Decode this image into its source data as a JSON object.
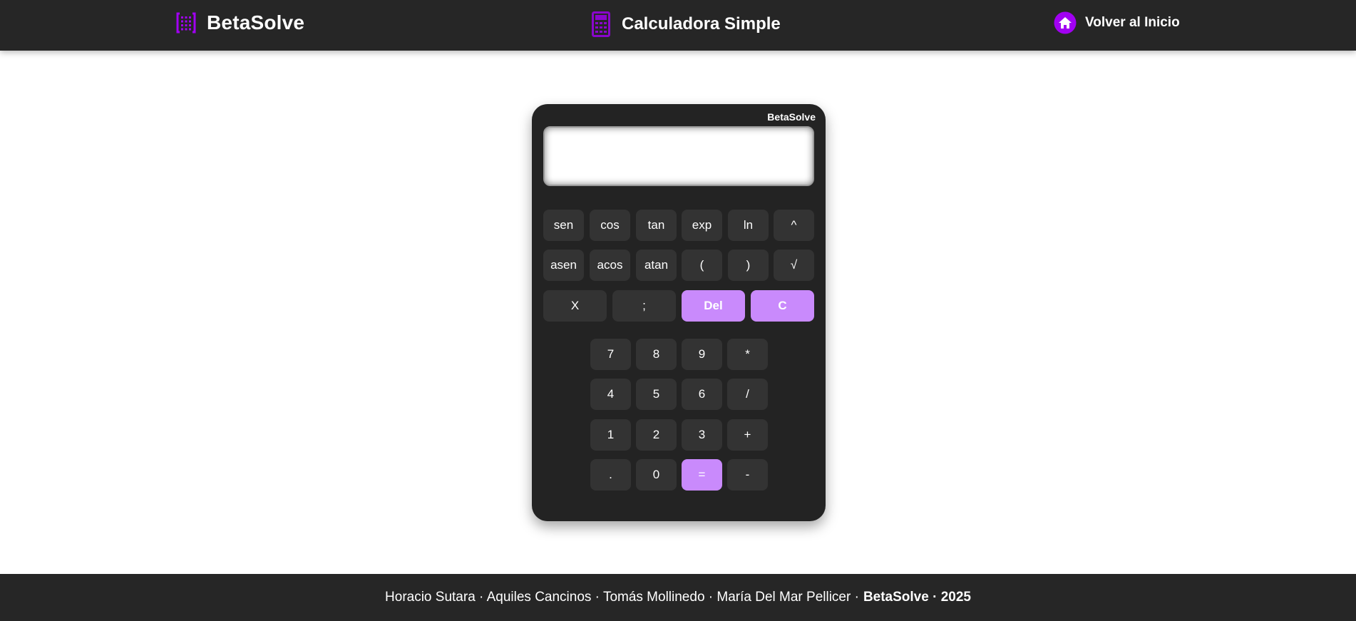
{
  "header": {
    "brand": "BetaSolve",
    "page_title": "Calculadora Simple",
    "home_link": "Volver al Inicio",
    "brand_icon": "calculator-dots-icon",
    "title_icon": "calculator-icon",
    "home_icon": "home-icon",
    "accent_color": "#a100f2"
  },
  "calculator": {
    "brand": "BetaSolve",
    "display_value": "",
    "accent_color": "#c98afc",
    "sci_row1": [
      "sen",
      "cos",
      "tan",
      "exp",
      "ln",
      "^"
    ],
    "sci_row2": [
      "asen",
      "acos",
      "atan",
      "(",
      ")",
      "√"
    ],
    "ctrl_row": [
      "X",
      ";",
      "Del",
      "C"
    ],
    "num_rows": [
      [
        "7",
        "8",
        "9",
        "*"
      ],
      [
        "4",
        "5",
        "6",
        "/"
      ],
      [
        "1",
        "2",
        "3",
        "+"
      ],
      [
        ".",
        "0",
        "=",
        "-"
      ]
    ]
  },
  "footer": {
    "authors": "Horacio Sutara · Aquiles Cancinos · Tomás Mollinedo · María Del Mar Pellicer ·",
    "brand_year": "BetaSolve · 2025"
  }
}
